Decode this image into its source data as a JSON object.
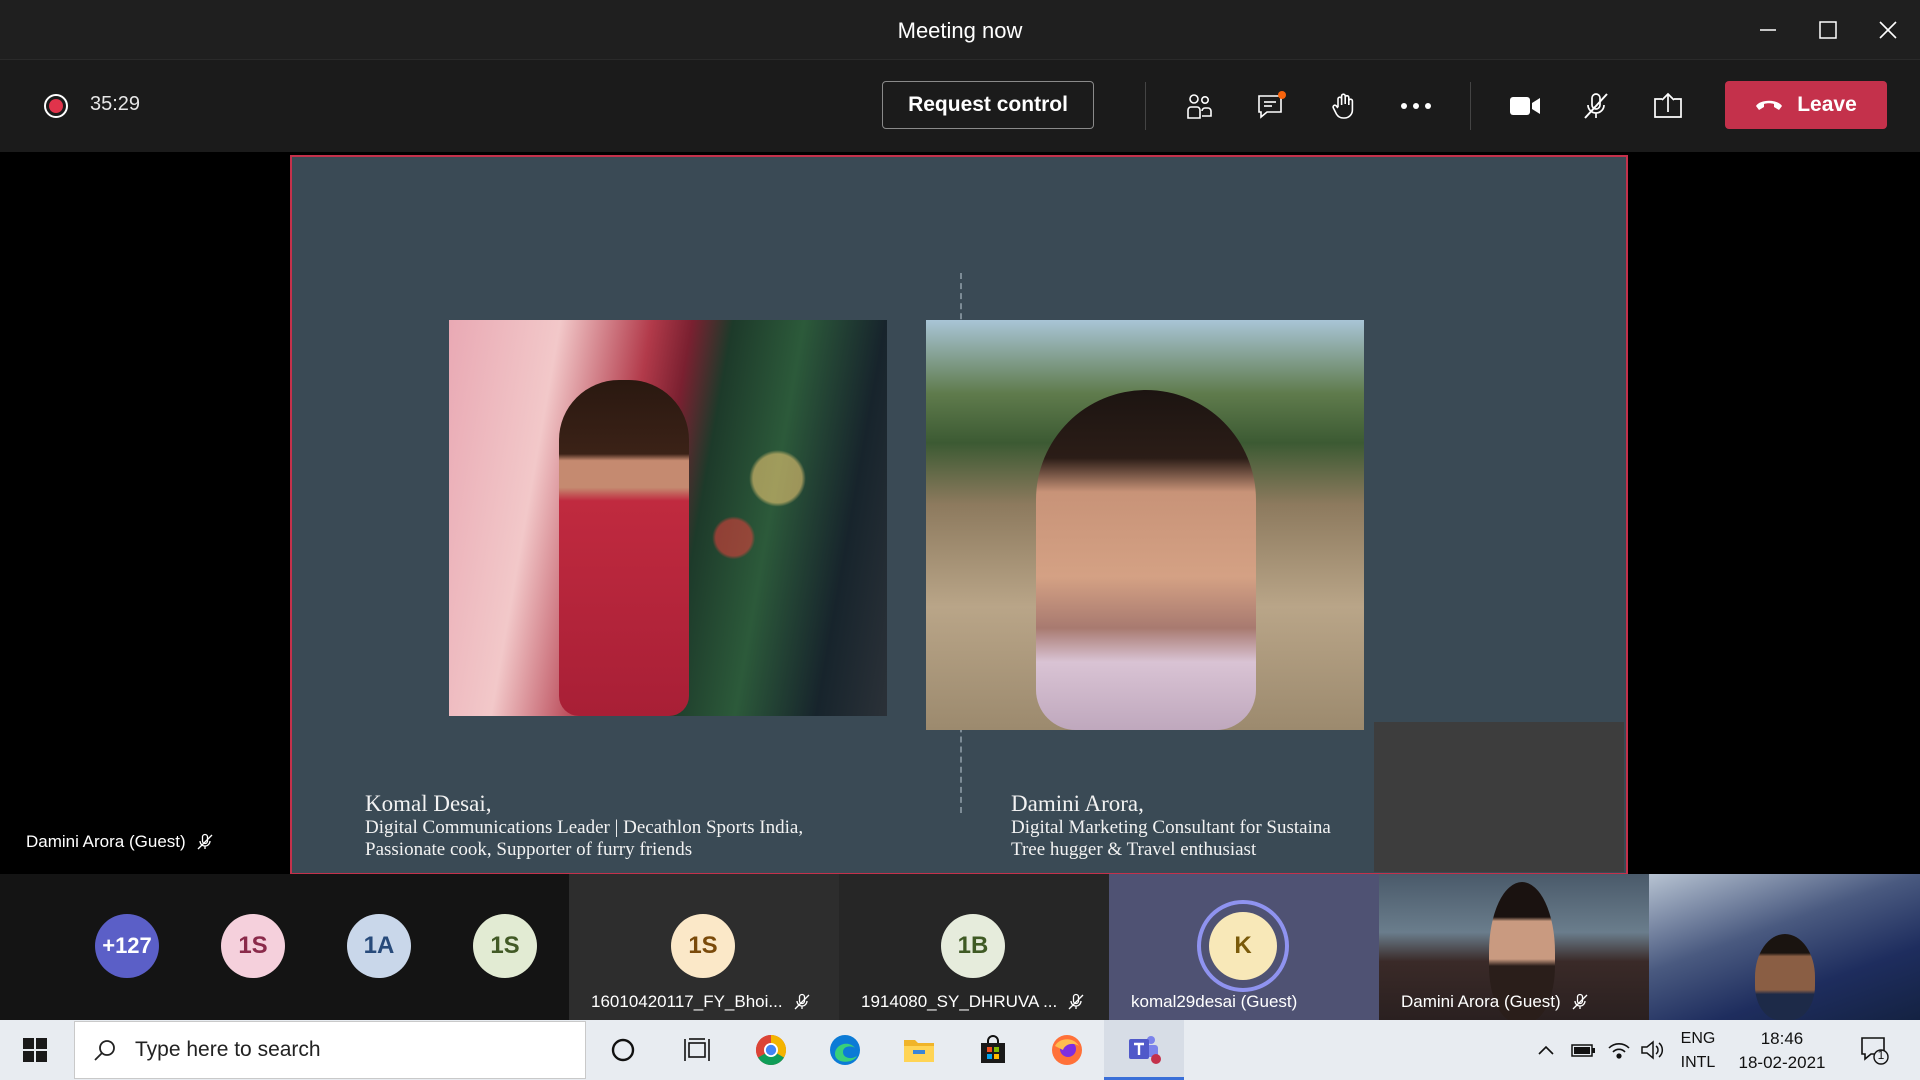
{
  "window": {
    "title": "Meeting now"
  },
  "controls": {
    "timer": "35:29",
    "request_control_label": "Request control",
    "leave_label": "Leave",
    "colors": {
      "leave": "#c4314b",
      "recording": "#e0334b",
      "notification": "#f7630c"
    }
  },
  "slide": {
    "left": {
      "name": "Komal Desai,",
      "line1": "Digital Communications Leader | Decathlon Sports India,",
      "line2": "Passionate cook, Supporter of furry friends"
    },
    "right": {
      "name": "Damini Arora,",
      "line1": "Digital Marketing Consultant for Sustaina",
      "line2": "Tree hugger & Travel enthusiast"
    }
  },
  "presenter_label": "Damini Arora (Guest)",
  "participants": {
    "overflow": {
      "text": "+127",
      "color": "#5b5fc7"
    },
    "avatars": [
      {
        "initials": "1S",
        "bg": "#f5d0dc",
        "fg": "#8a2a4a"
      },
      {
        "initials": "1A",
        "bg": "#c9d7ea",
        "fg": "#274a7a"
      },
      {
        "initials": "1S",
        "bg": "#e2ebd3",
        "fg": "#425a26"
      }
    ],
    "tiles": [
      {
        "initials": "1S",
        "name": "16010420117_FY_Bhoi...",
        "bg": "#fbe8c8",
        "fg": "#7a4a0a"
      },
      {
        "initials": "1B",
        "name": "1914080_SY_DHRUVA ...",
        "bg": "#e6ecdc",
        "fg": "#3f5a24"
      },
      {
        "initials": "K",
        "name": "komal29desai (Guest)",
        "bg": "#f8e8b8",
        "fg": "#7a5a0a"
      },
      {
        "name": "Damini Arora (Guest)"
      }
    ]
  },
  "taskbar": {
    "search_placeholder": "Type here to search",
    "lang_line1": "ENG",
    "lang_line2": "INTL",
    "time": "18:46",
    "date": "18-02-2021",
    "notification_count": "1"
  }
}
